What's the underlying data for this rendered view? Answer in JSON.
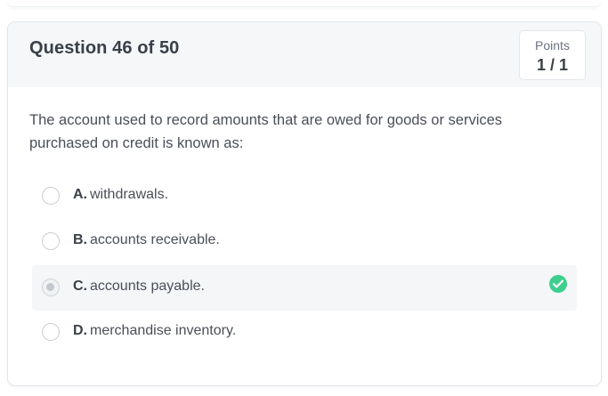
{
  "header": {
    "question_title": "Question 46 of 50",
    "points_label": "Points",
    "points_value": "1 / 1"
  },
  "question": {
    "text": "The account used to record amounts that are owed for goods or services purchased on credit is known as:"
  },
  "options": [
    {
      "letter": "A.",
      "text": "withdrawals.",
      "selected": false,
      "correct": false
    },
    {
      "letter": "B.",
      "text": "accounts receivable.",
      "selected": false,
      "correct": false
    },
    {
      "letter": "C.",
      "text": "accounts payable.",
      "selected": true,
      "correct": true
    },
    {
      "letter": "D.",
      "text": "merchandise inventory.",
      "selected": false,
      "correct": false
    }
  ],
  "icons": {
    "correct": "check-circle-icon"
  },
  "colors": {
    "correct_green": "#3ecf8e",
    "header_bg": "#f5f7f9"
  }
}
